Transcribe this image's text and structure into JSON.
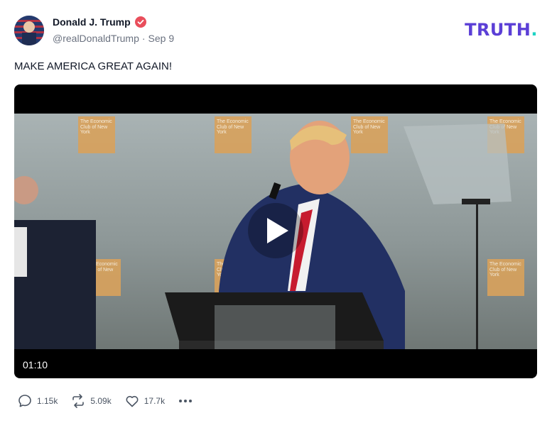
{
  "post": {
    "author_name": "Donald J. Trump",
    "handle": "@realDonaldTrump",
    "separator": "·",
    "date": "Sep 9",
    "text": "MAKE AMERICA GREAT AGAIN!",
    "brand": "TRUTH",
    "brand_dot": ".",
    "verified_icon": "verified-badge-icon"
  },
  "video": {
    "duration": "01:10",
    "sign_text": "The Economic Club of New York",
    "play_icon": "play-icon"
  },
  "actions": {
    "replies": "1.15k",
    "retruths": "5.09k",
    "likes": "17.7k",
    "more_icon": "more-icon"
  },
  "colors": {
    "brand": "#5b3fd6",
    "brand_dot": "#1dd3c4",
    "verified": "#e94e5b",
    "text_muted": "#6b7280"
  }
}
